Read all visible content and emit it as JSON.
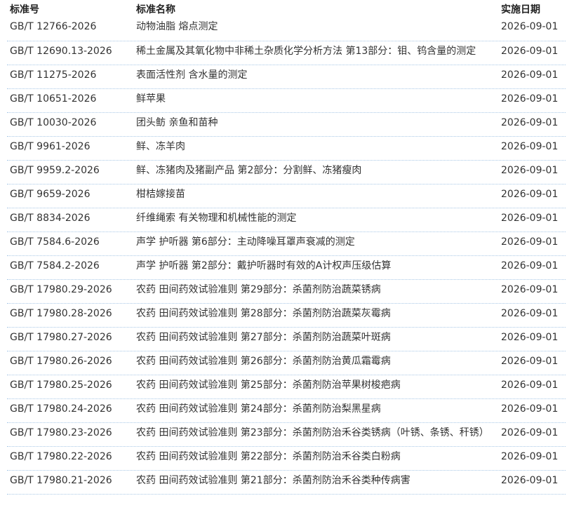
{
  "table": {
    "headers": {
      "code": "标准号",
      "name": "标准名称",
      "date": "实施日期"
    },
    "rows": [
      {
        "code": "GB/T 12766-2026",
        "name": "动物油脂 熔点测定",
        "date": "2026-09-01"
      },
      {
        "code": "GB/T 12690.13-2026",
        "name": "稀土金属及其氧化物中非稀土杂质化学分析方法 第13部分：钼、钨含量的测定",
        "date": "2026-09-01"
      },
      {
        "code": "GB/T 11275-2026",
        "name": "表面活性剂 含水量的测定",
        "date": "2026-09-01"
      },
      {
        "code": "GB/T 10651-2026",
        "name": "鲜苹果",
        "date": "2026-09-01"
      },
      {
        "code": "GB/T 10030-2026",
        "name": "团头鲂 亲鱼和苗种",
        "date": "2026-09-01"
      },
      {
        "code": "GB/T 9961-2026",
        "name": "鲜、冻羊肉",
        "date": "2026-09-01"
      },
      {
        "code": "GB/T 9959.2-2026",
        "name": "鲜、冻猪肉及猪副产品 第2部分：分割鲜、冻猪瘦肉",
        "date": "2026-09-01"
      },
      {
        "code": "GB/T 9659-2026",
        "name": "柑桔嫁接苗",
        "date": "2026-09-01"
      },
      {
        "code": "GB/T 8834-2026",
        "name": "纤维绳索 有关物理和机械性能的测定",
        "date": "2026-09-01"
      },
      {
        "code": "GB/T 7584.6-2026",
        "name": "声学 护听器 第6部分：主动降噪耳罩声衰减的测定",
        "date": "2026-09-01"
      },
      {
        "code": "GB/T 7584.2-2026",
        "name": "声学 护听器 第2部分：戴护听器时有效的A计权声压级估算",
        "date": "2026-09-01"
      },
      {
        "code": "GB/T 17980.29-2026",
        "name": "农药 田间药效试验准则 第29部分：杀菌剂防治蔬菜锈病",
        "date": "2026-09-01"
      },
      {
        "code": "GB/T 17980.28-2026",
        "name": "农药 田间药效试验准则 第28部分：杀菌剂防治蔬菜灰霉病",
        "date": "2026-09-01"
      },
      {
        "code": "GB/T 17980.27-2026",
        "name": "农药 田间药效试验准则 第27部分：杀菌剂防治蔬菜叶斑病",
        "date": "2026-09-01"
      },
      {
        "code": "GB/T 17980.26-2026",
        "name": "农药 田间药效试验准则 第26部分：杀菌剂防治黄瓜霜霉病",
        "date": "2026-09-01"
      },
      {
        "code": "GB/T 17980.25-2026",
        "name": "农药 田间药效试验准则 第25部分：杀菌剂防治苹果树梭疤病",
        "date": "2026-09-01"
      },
      {
        "code": "GB/T 17980.24-2026",
        "name": "农药 田间药效试验准则 第24部分：杀菌剂防治梨黑星病",
        "date": "2026-09-01"
      },
      {
        "code": "GB/T 17980.23-2026",
        "name": "农药 田间药效试验准则 第23部分：杀菌剂防治禾谷类锈病（叶锈、条锈、秆锈）",
        "date": "2026-09-01"
      },
      {
        "code": "GB/T 17980.22-2026",
        "name": "农药 田间药效试验准则 第22部分：杀菌剂防治禾谷类白粉病",
        "date": "2026-09-01"
      },
      {
        "code": "GB/T 17980.21-2026",
        "name": "农药 田间药效试验准则 第21部分：杀菌剂防治禾谷类种传病害",
        "date": "2026-09-01"
      }
    ]
  }
}
